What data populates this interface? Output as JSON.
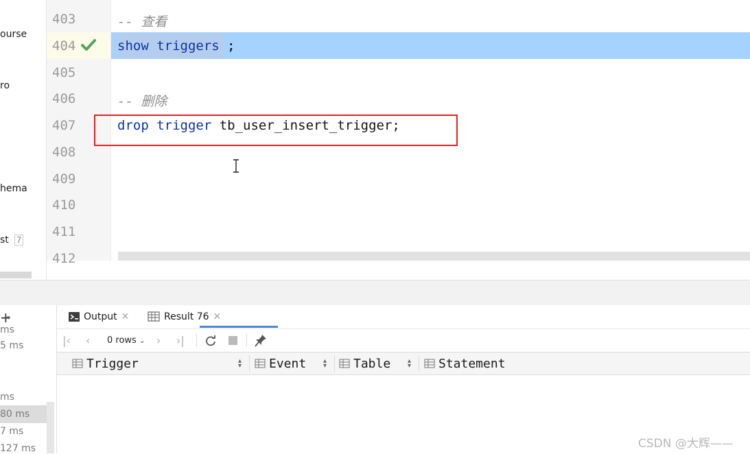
{
  "sidebar": {
    "items": [
      {
        "label": "ourse"
      },
      {
        "label": "ro"
      },
      {
        "label": "hema"
      },
      {
        "label": "st",
        "badge": "7"
      }
    ]
  },
  "editor": {
    "line_numbers": [
      "403",
      "404",
      "405",
      "406",
      "407",
      "408",
      "409",
      "410",
      "411",
      "412"
    ],
    "lines": {
      "l403_prefix": "-- ",
      "l403_comment": "查看",
      "l404_kw1": "show",
      "l404_kw2": "triggers",
      "l404_tail": " ;",
      "l406_prefix": "-- ",
      "l406_comment": "删除",
      "l407_kw1": "drop",
      "l407_kw2": "trigger",
      "l407_tail": " tb_user_insert_trigger;"
    }
  },
  "services": {
    "plus": "+",
    "times": [
      "ms",
      "5 ms",
      "ms",
      "80 ms",
      "7 ms",
      "127 ms"
    ]
  },
  "tabs": [
    {
      "label": "Output",
      "icon": "output-console-icon"
    },
    {
      "label": "Result 76",
      "icon": "table-grid-icon"
    }
  ],
  "toolbar": {
    "rows": "0 rows",
    "buttons": [
      "first-page-icon",
      "prev-page-icon",
      "next-page-icon",
      "last-page-icon",
      "refresh-icon",
      "stop-icon",
      "pin-icon"
    ]
  },
  "grid": {
    "columns": [
      "Trigger",
      "Event",
      "Table",
      "Statement"
    ]
  },
  "watermark": "CSDN @大辉——",
  "colors": {
    "selection": "#a6d2ff",
    "keyword": "#0b34a3",
    "annotation_box": "#e02222",
    "check": "#5aa25a"
  }
}
